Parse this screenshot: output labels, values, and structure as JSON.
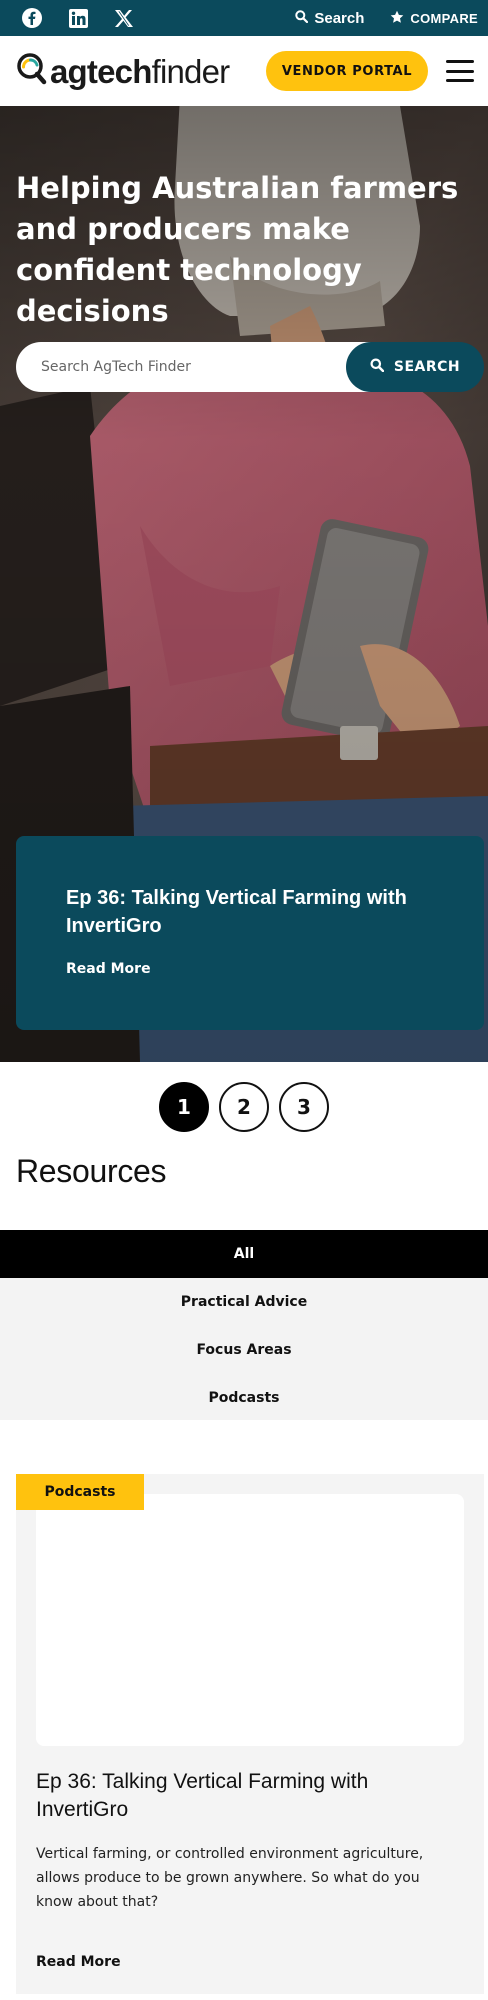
{
  "topbar": {
    "social": [
      {
        "icon": "facebook-icon"
      },
      {
        "icon": "linkedin-icon"
      },
      {
        "icon": "x-icon"
      }
    ],
    "search_label": "Search",
    "compare_label": "COMPARE"
  },
  "header": {
    "logo_prefix": "agtech",
    "logo_suffix": "finder",
    "vendor_portal_label": "VENDOR PORTAL"
  },
  "hero": {
    "title": "Helping Australian farmers and producers make confident technology decisions",
    "search_placeholder": "Search AgTech Finder",
    "search_button": "SEARCH",
    "feature_title": "Ep 36: Talking Vertical Farming with InvertiGro",
    "feature_link": "Read More"
  },
  "pager": {
    "pages": [
      "1",
      "2",
      "3"
    ],
    "active": "1"
  },
  "resources": {
    "title": "Resources",
    "filters": [
      "All",
      "Practical Advice",
      "Focus Areas",
      "Podcasts"
    ],
    "active_filter": "All",
    "card": {
      "tag": "Podcasts",
      "title": "Ep 36: Talking Vertical Farming with InvertiGro",
      "excerpt": "Vertical farming, or controlled environment agriculture, allows produce to be grown anywhere. So what do you know about that?",
      "link": "Read More"
    }
  },
  "colors": {
    "brand_teal": "#0b4a5c",
    "accent_yellow": "#ffc20e"
  }
}
